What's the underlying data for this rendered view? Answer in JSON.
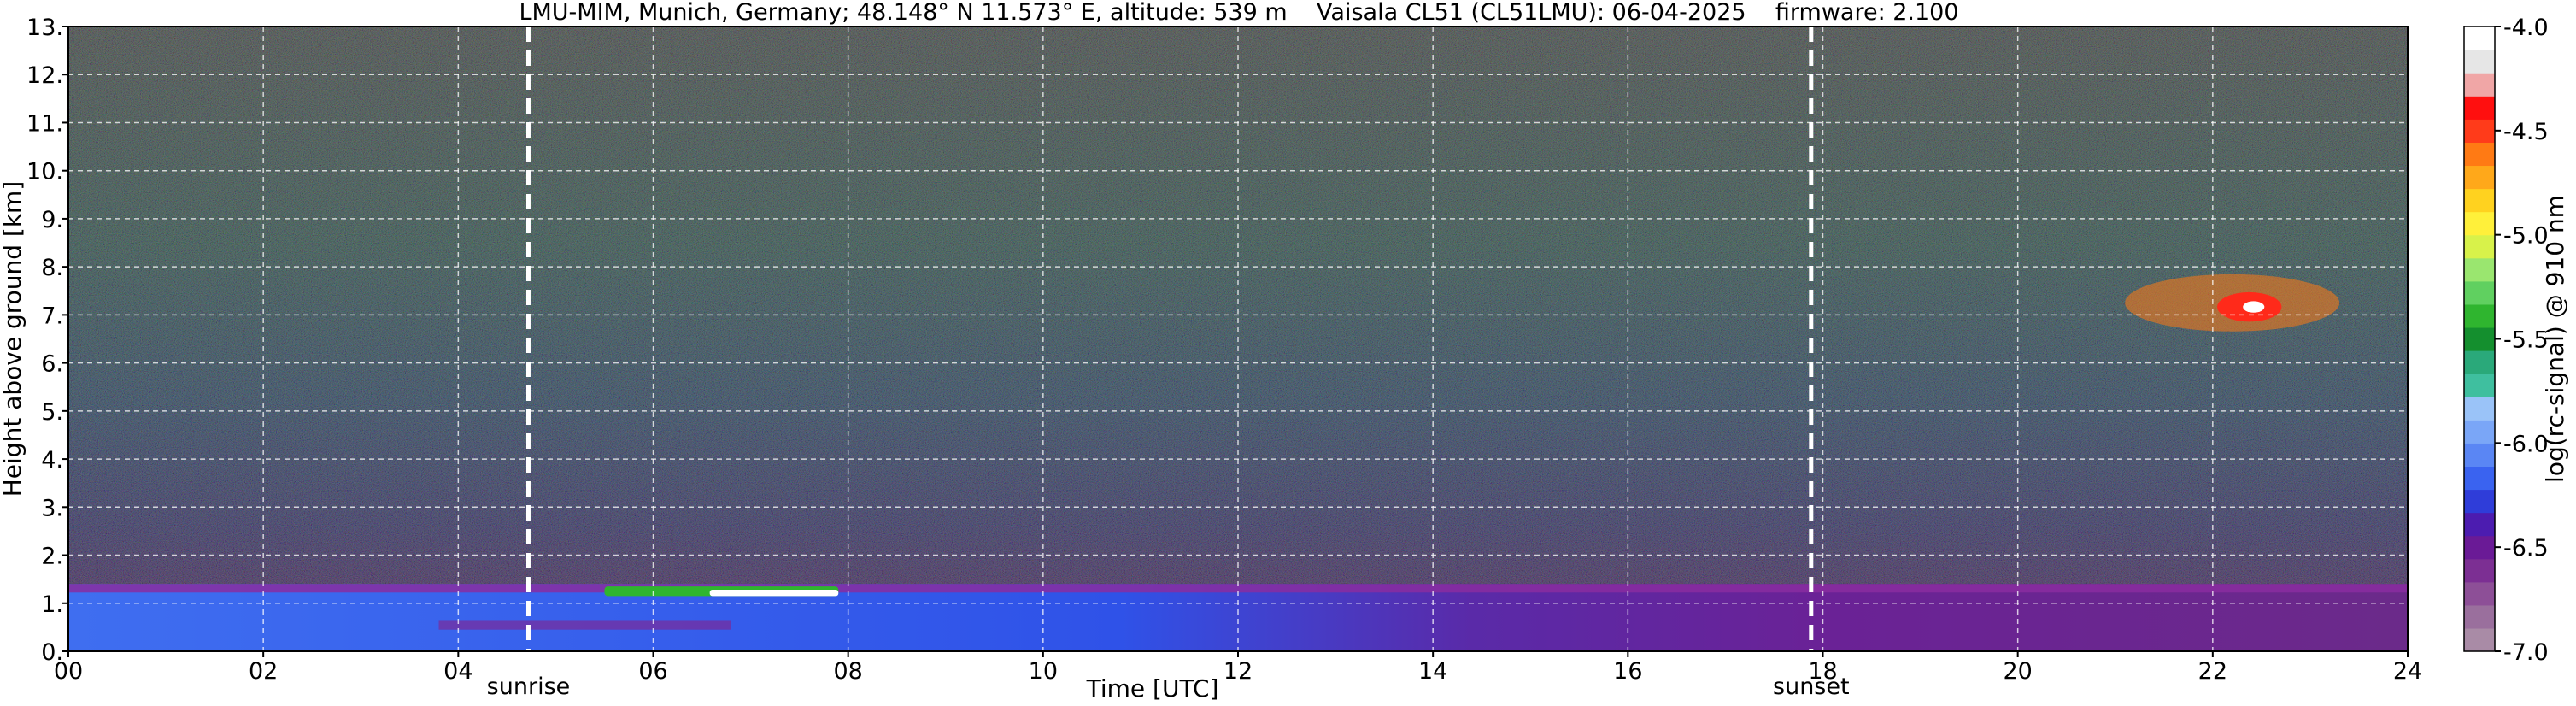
{
  "chart_data": {
    "type": "heatmap",
    "title": "LMU-MIM, Munich, Germany; 48.148° N 11.573° E, altitude: 539 m    Vaisala CL51 (CL51LMU): 06-04-2025    firmware: 2.100",
    "xlabel": "Time [UTC]",
    "ylabel": "Height above ground [km]",
    "xlim": [
      0,
      24
    ],
    "ylim": [
      0,
      13
    ],
    "x_ticks": [
      "00",
      "02",
      "04",
      "06",
      "08",
      "10",
      "12",
      "14",
      "16",
      "18",
      "20",
      "22",
      "24"
    ],
    "y_ticks": [
      "0.",
      "1.",
      "2.",
      "3.",
      "4.",
      "5.",
      "6.",
      "7.",
      "8.",
      "9.",
      "10.",
      "11.",
      "12.",
      "13."
    ],
    "grid": true,
    "colorbar": {
      "label": "log(rc-signal) @ 910 nm",
      "range": [
        -7.0,
        -4.0
      ],
      "ticks": [
        "-4.0",
        "-4.5",
        "-5.0",
        "-5.5",
        "-6.0",
        "-6.5",
        "-7.0"
      ],
      "colors": [
        "#a98ba6",
        "#9a6f9d",
        "#8d4f97",
        "#7c2f93",
        "#6a1a96",
        "#4c1cb0",
        "#2f3dd9",
        "#3a63f0",
        "#5a86f4",
        "#7aa6f7",
        "#9ac3f8",
        "#3fbf9f",
        "#2aa97a",
        "#148f2e",
        "#2fb52f",
        "#60d060",
        "#9ae66f",
        "#d8f24a",
        "#fff03a",
        "#ffd21f",
        "#ffa81a",
        "#ff7a14",
        "#ff3b1a",
        "#ff0f0f",
        "#f0a6a6",
        "#e6e6e6",
        "#ffffff"
      ]
    },
    "markers": [
      {
        "label": "sunrise",
        "x": 4.72
      },
      {
        "label": "sunset",
        "x": 17.88
      }
    ],
    "features": [
      {
        "kind": "boundary layer",
        "x_range": [
          0,
          24
        ],
        "height_km": [
          0,
          1.4
        ]
      },
      {
        "kind": "cloud",
        "x_range": [
          5.5,
          7.9
        ],
        "height_km": [
          1.15,
          1.35
        ]
      },
      {
        "kind": "cloud",
        "x_range": [
          21.1,
          23.3
        ],
        "height_km": [
          6.4,
          8.1
        ]
      }
    ]
  }
}
